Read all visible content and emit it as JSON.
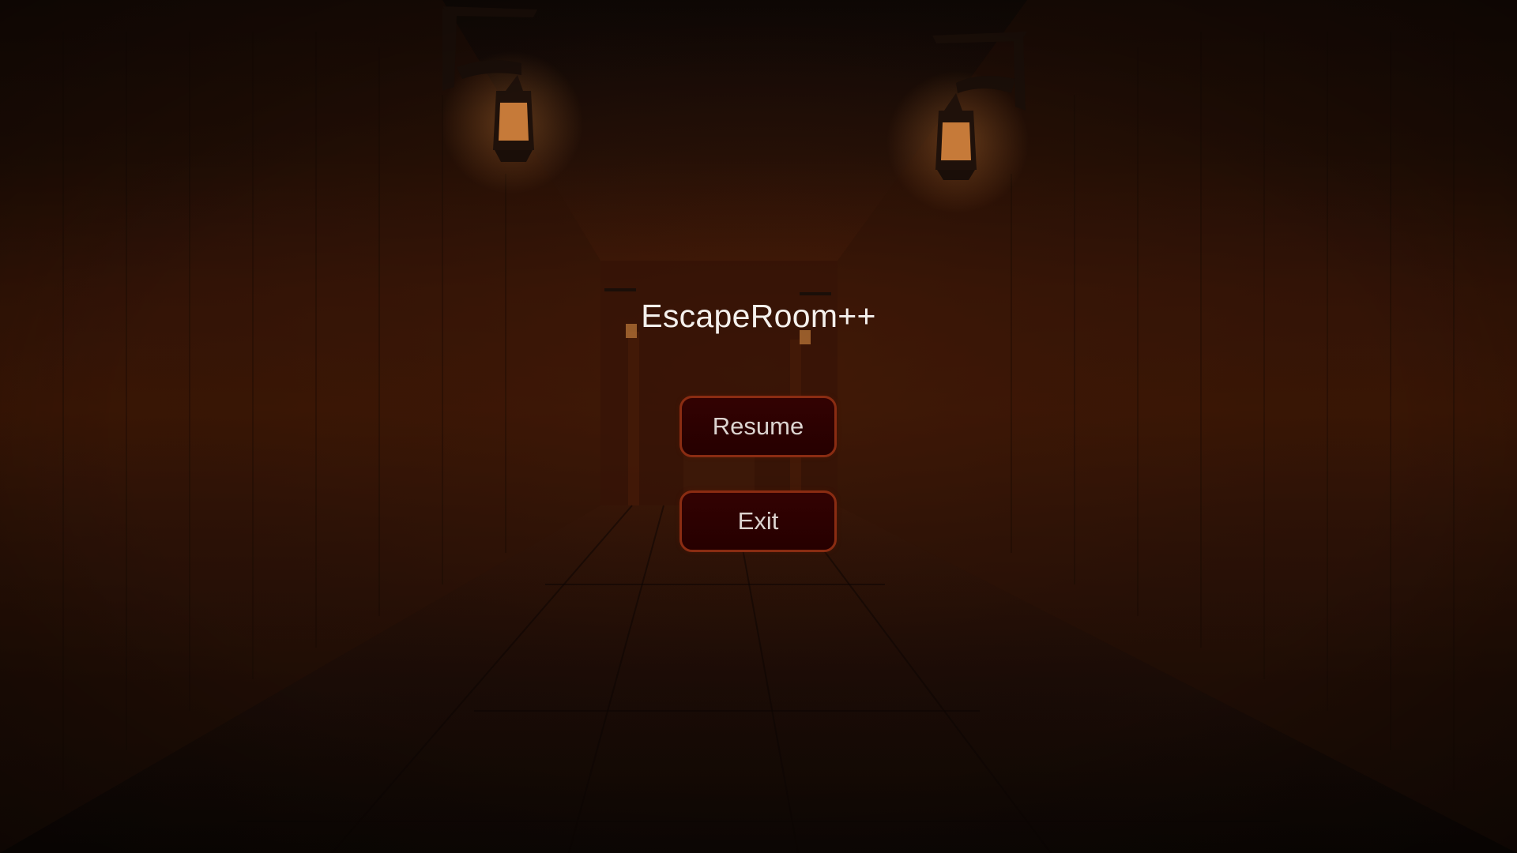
{
  "game": {
    "title": "EscapeRoom++"
  },
  "pause_menu": {
    "buttons": [
      {
        "label": "Resume"
      },
      {
        "label": "Exit"
      }
    ]
  },
  "scene": {
    "description_icon": "dim-wooden-corridor-with-wall-lanterns",
    "colors": {
      "ambient_glow": "#4a1a05",
      "shadow": "#120904",
      "lantern_light": "#d8863e",
      "button_fill": "#2b0000",
      "button_border": "#8a2c12",
      "title_text": "#f4f0ec",
      "button_text": "#dcd4d0"
    }
  }
}
